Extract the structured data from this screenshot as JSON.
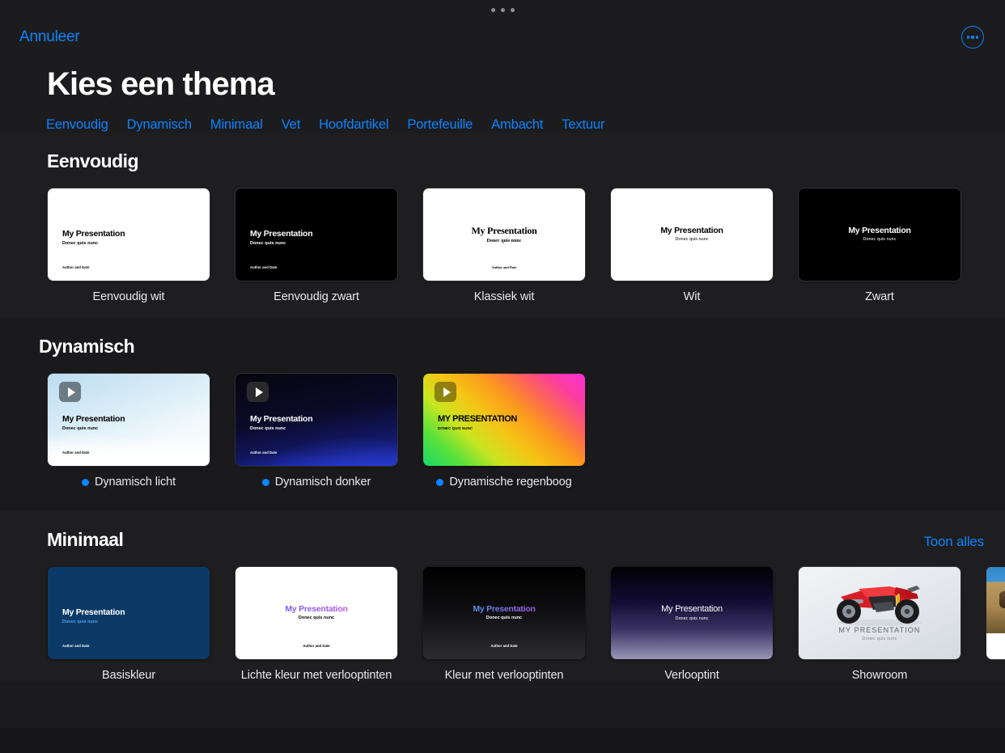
{
  "window": {
    "grabber": "sheet-grabber"
  },
  "navbar": {
    "cancel_label": "Annuleer",
    "more_icon": "ellipsis-circle-icon"
  },
  "header": {
    "title": "Kies een thema"
  },
  "tabs": [
    {
      "label": "Eenvoudig"
    },
    {
      "label": "Dynamisch"
    },
    {
      "label": "Minimaal"
    },
    {
      "label": "Vet"
    },
    {
      "label": "Hoofdartikel"
    },
    {
      "label": "Portefeuille"
    },
    {
      "label": "Ambacht"
    },
    {
      "label": "Textuur"
    }
  ],
  "slide_text": {
    "title": "My Presentation",
    "title_caps": "MY PRESENTATION",
    "subtitle": "Donec quis nunc",
    "subtitle_caps": "DONEC QUIS NUNC",
    "footer": "Author and Date"
  },
  "sections": [
    {
      "title": "Eenvoudig",
      "show_all": null,
      "themes": [
        {
          "name": "Eenvoudig wit"
        },
        {
          "name": "Eenvoudig zwart"
        },
        {
          "name": "Klassiek wit"
        },
        {
          "name": "Wit"
        },
        {
          "name": "Zwart"
        }
      ]
    },
    {
      "title": "Dynamisch",
      "show_all": null,
      "themes": [
        {
          "name": "Dynamisch licht",
          "badge": "download-dot"
        },
        {
          "name": "Dynamisch donker",
          "badge": "download-dot"
        },
        {
          "name": "Dynamische regenboog",
          "badge": "download-dot"
        }
      ]
    },
    {
      "title": "Minimaal",
      "show_all": "Toon alles",
      "themes": [
        {
          "name": "Basiskleur"
        },
        {
          "name": "Lichte kleur met verlooptinten"
        },
        {
          "name": "Kleur met verlooptinten"
        },
        {
          "name": "Verlooptint"
        },
        {
          "name": "Showroom"
        },
        {
          "name": ""
        }
      ]
    }
  ],
  "colors": {
    "accent": "#0a84ff",
    "background": "#1c1c1e",
    "section_shaded": "#1a1a1c",
    "text_primary": "#ffffff",
    "text_caption": "#e9e9ea"
  }
}
